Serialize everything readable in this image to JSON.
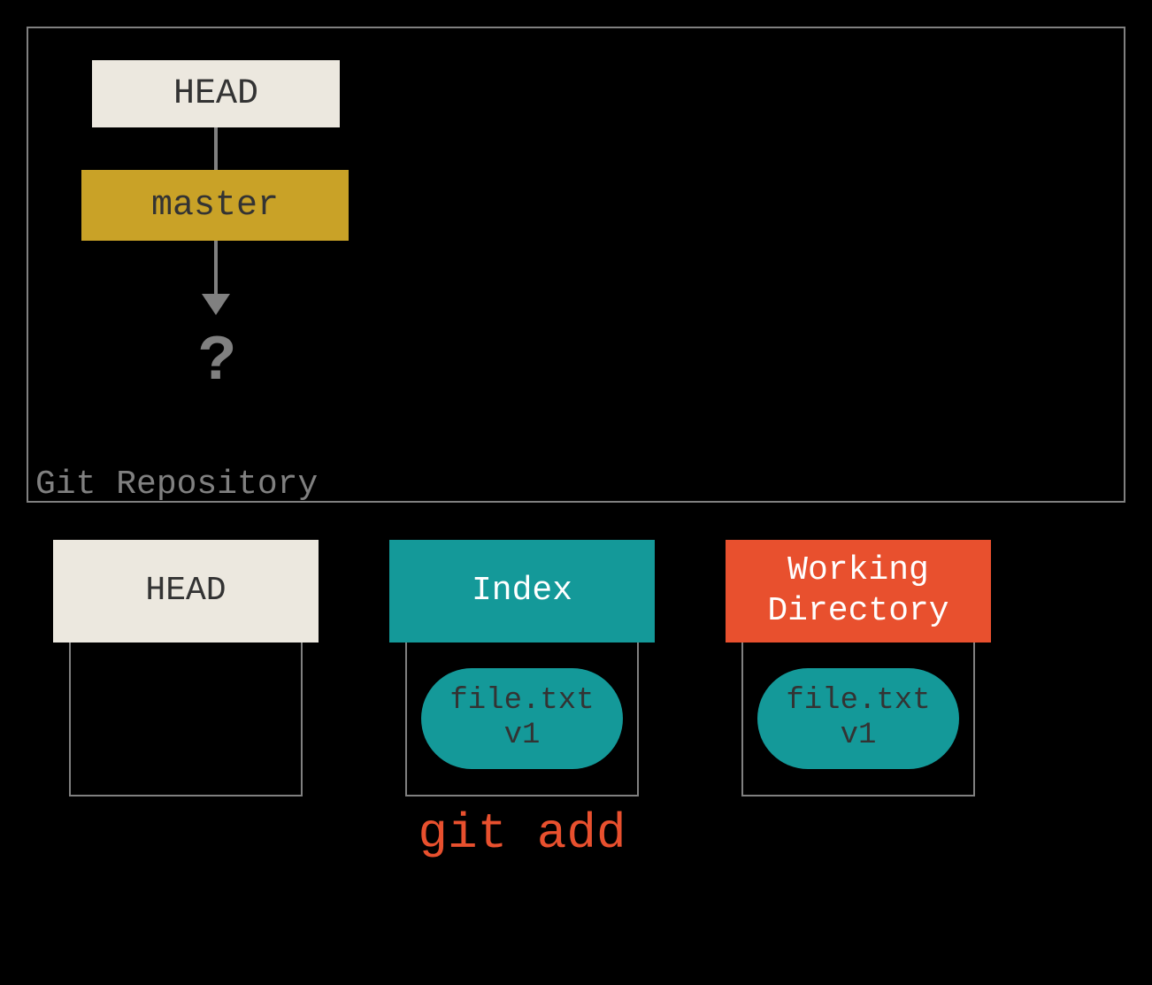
{
  "repo": {
    "label": "Git Repository",
    "head": "HEAD",
    "branch": "master",
    "unknown": "?"
  },
  "areas": {
    "head": {
      "label": "HEAD"
    },
    "index": {
      "label": "Index",
      "file_name": "file.txt",
      "file_version": "v1"
    },
    "working": {
      "label": "Working\nDirectory",
      "file_name": "file.txt",
      "file_version": "v1"
    }
  },
  "command": "git add"
}
